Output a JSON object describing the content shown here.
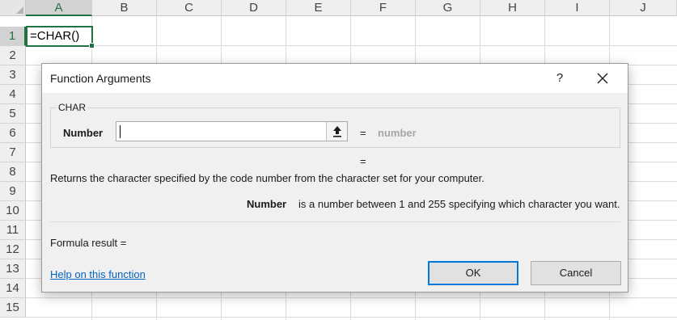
{
  "sheet": {
    "columns": [
      "A",
      "B",
      "C",
      "D",
      "E",
      "F",
      "G",
      "H",
      "I",
      "J"
    ],
    "rows": [
      "1",
      "2",
      "3",
      "4",
      "5",
      "6",
      "7",
      "8",
      "9",
      "10",
      "11",
      "12",
      "13",
      "14",
      "15"
    ],
    "active_cell_value": "=CHAR()",
    "accent_color": "#217346"
  },
  "dialog": {
    "title": "Function Arguments",
    "help_glyph": "?",
    "function_name": "CHAR",
    "argument_label": "Number",
    "argument_value": "",
    "equals": "=",
    "argument_result_hint": "number",
    "function_result_equals": "=",
    "description": "Returns the character specified by the code number from the character set for your computer.",
    "argument_description_name": "Number",
    "argument_description_text": "is a number between 1 and 255 specifying which character you want.",
    "formula_result_label": "Formula result =",
    "help_link": "Help on this function",
    "ok_label": "OK",
    "cancel_label": "Cancel",
    "link_color": "#0563c1",
    "focus_color": "#0078d7"
  }
}
